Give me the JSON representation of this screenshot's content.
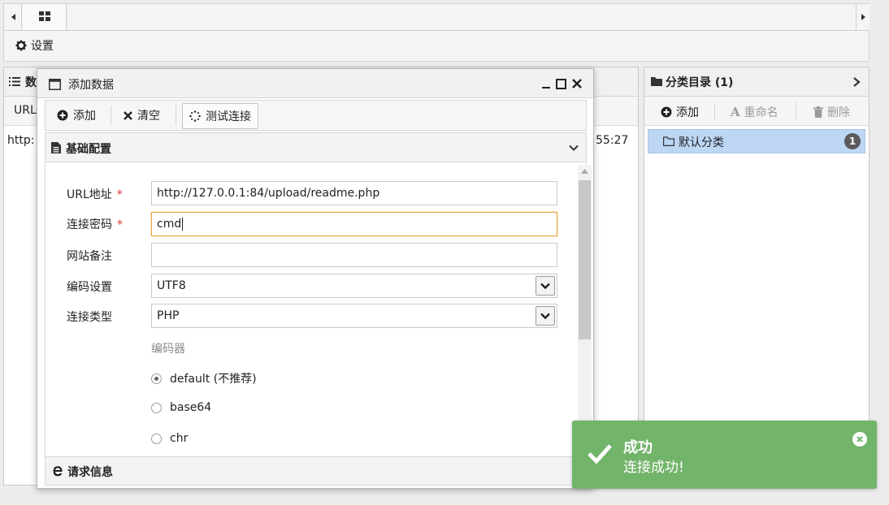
{
  "toolbar": {
    "settings_label": "设置"
  },
  "left_panel": {
    "title": "数",
    "col_url": "URL",
    "row_url": "http:",
    "row_time": "55:27"
  },
  "dialog": {
    "title": "添加数据",
    "buttons": {
      "add": "添加",
      "clear": "清空",
      "test": "测试连接"
    },
    "section_basic": "基础配置",
    "section_request": "请求信息",
    "fields": {
      "url": {
        "label": "URL地址",
        "required": "*",
        "value": "http://127.0.0.1:84/upload/readme.php"
      },
      "password": {
        "label": "连接密码",
        "required": "*",
        "value": "cmd"
      },
      "note": {
        "label": "网站备注",
        "value": ""
      },
      "encoding": {
        "label": "编码设置",
        "value": "UTF8"
      },
      "type": {
        "label": "连接类型",
        "value": "PHP"
      }
    },
    "encoder": {
      "label": "编码器",
      "options": [
        "default (不推荐)",
        "base64",
        "chr"
      ],
      "selected": "default (不推荐)"
    }
  },
  "right_panel": {
    "title": "分类目录 (1)",
    "toolbar": {
      "add": "添加",
      "rename": "重命名",
      "delete": "删除"
    },
    "categories": [
      {
        "name": "默认分类",
        "count": "1"
      }
    ]
  },
  "toast": {
    "title": "成功",
    "message": "连接成功!",
    "color": "#72b46a"
  }
}
